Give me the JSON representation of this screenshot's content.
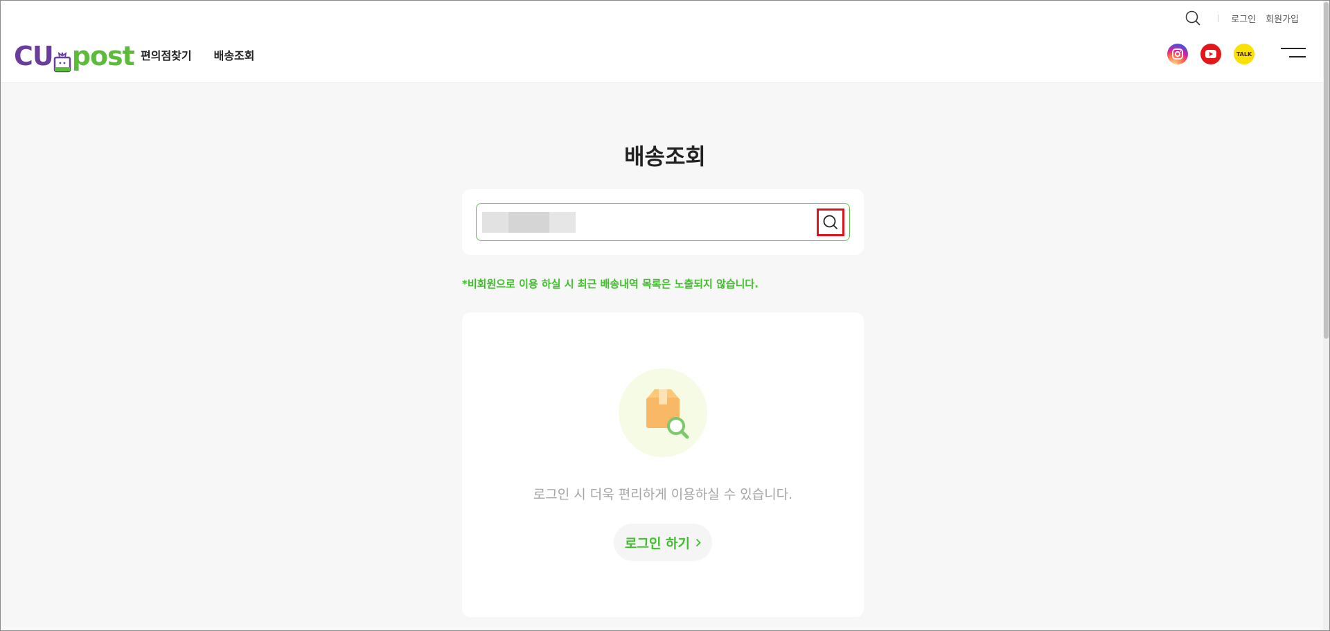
{
  "header": {
    "util": {
      "login": "로그인",
      "signup": "회원가입"
    },
    "logo": {
      "part1": "CU",
      "part2": "post"
    },
    "nav": [
      "편의점찾기",
      "배송조회"
    ],
    "sns": {
      "kakao_label": "TALK"
    }
  },
  "main": {
    "title": "배송조회",
    "search": {
      "value": "",
      "placeholder": ""
    },
    "notice": "*비회원으로 이용 하실 시 최근 배송내역 목록은 노출되지 않습니다.",
    "login_card": {
      "message": "로그인 시 더욱 편리하게 이용하실 수 있습니다.",
      "button": "로그인 하기"
    }
  },
  "colors": {
    "brand_green": "#3fbf2b",
    "brand_purple": "#6a3c9b",
    "highlight_red": "#e0121b"
  }
}
